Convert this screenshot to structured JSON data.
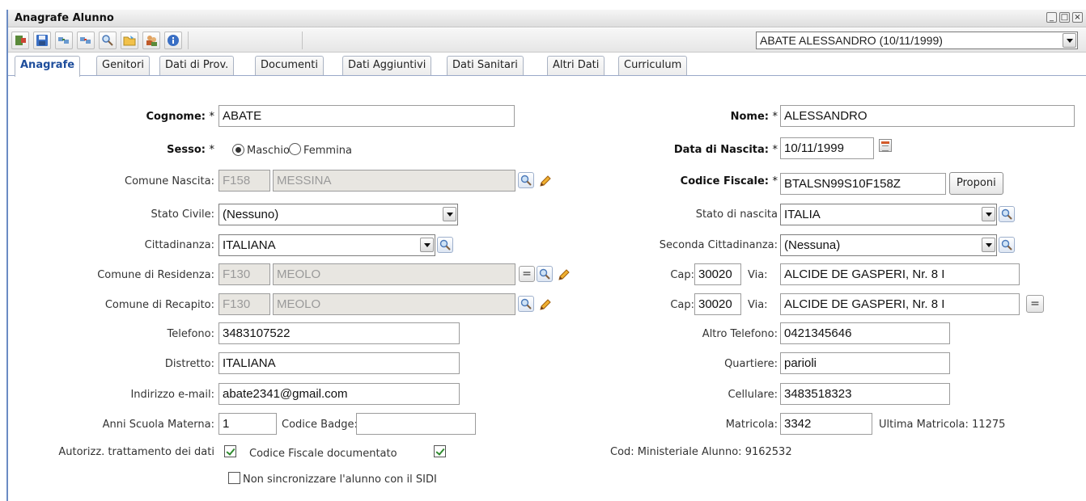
{
  "window": {
    "title": "Anagrafe Alunno"
  },
  "toolbar": {
    "buttons": [
      "exit-icon",
      "save-icon",
      "copy-record-icon",
      "delete-record-icon",
      "search-icon",
      "folder-icon",
      "users-icon",
      "info-icon"
    ],
    "student_selector": "ABATE ALESSANDRO (10/11/1999)"
  },
  "tabs": [
    "Anagrafe",
    "Genitori",
    "Dati di Prov.",
    "Documenti",
    "Dati Aggiuntivi",
    "Dati Sanitari",
    "Altri Dati",
    "Curriculum"
  ],
  "form": {
    "cognome": {
      "label": "Cognome:",
      "req": "*",
      "value": "ABATE"
    },
    "nome": {
      "label": "Nome:",
      "req": "*",
      "value": "ALESSANDRO"
    },
    "sesso": {
      "label": "Sesso:",
      "req": "*",
      "maschio": "Maschio",
      "femmina": "Femmina",
      "selected": "Maschio"
    },
    "data_nascita": {
      "label": "Data di Nascita:",
      "req": "*",
      "value": "10/11/1999"
    },
    "comune_nascita": {
      "label": "Comune Nascita:",
      "code": "F158",
      "name": "MESSINA"
    },
    "codice_fiscale": {
      "label": "Codice Fiscale:",
      "req": "*",
      "value": "BTALSN99S10F158Z",
      "button": "Proponi"
    },
    "stato_civile": {
      "label": "Stato Civile:",
      "value": "(Nessuno)"
    },
    "stato_nascita": {
      "label": "Stato di nascita",
      "value": "ITALIA"
    },
    "cittadinanza": {
      "label": "Cittadinanza:",
      "value": "ITALIANA"
    },
    "seconda_cittadinanza": {
      "label": "Seconda Cittadinanza:",
      "value": "(Nessuna)"
    },
    "comune_residenza": {
      "label": "Comune di Residenza:",
      "code": "F130",
      "name": "MEOLO"
    },
    "residenza_cap": {
      "cap_label": "Cap:",
      "cap": "30020",
      "via_label": "Via:",
      "via": "ALCIDE DE GASPERI, Nr. 8 I"
    },
    "comune_recapito": {
      "label": "Comune di Recapito:",
      "code": "F130",
      "name": "MEOLO"
    },
    "recapito_cap": {
      "cap_label": "Cap:",
      "cap": "30020",
      "via_label": "Via:",
      "via": "ALCIDE DE GASPERI, Nr. 8 I"
    },
    "telefono": {
      "label": "Telefono:",
      "value": "3483107522"
    },
    "altro_telefono": {
      "label": "Altro Telefono:",
      "value": "0421345646"
    },
    "distretto": {
      "label": "Distretto:",
      "value": "ITALIANA"
    },
    "quartiere": {
      "label": "Quartiere:",
      "value": "parioli"
    },
    "email": {
      "label": "Indirizzo e-mail:",
      "value": "abate2341@gmail.com"
    },
    "cellulare": {
      "label": "Cellulare:",
      "value": "3483518323"
    },
    "anni_materna": {
      "label": "Anni Scuola Materna:",
      "value": "1"
    },
    "codice_badge": {
      "label": "Codice Badge:",
      "value": ""
    },
    "matricola": {
      "label": "Matricola:",
      "value": "3342",
      "ultima_label": "Ultima Matricola: 11275"
    },
    "autorizz": {
      "label": "Autorizz. trattamento dei dati",
      "checked": true
    },
    "cf_documentato": {
      "label": "Codice Fiscale documentato",
      "checked": true
    },
    "cod_ministeriale": {
      "label": "Cod: Ministeriale Alunno: 9162532"
    },
    "non_sincronizzare": {
      "label": "Non sincronizzare l'alunno con il SIDI",
      "checked": false
    },
    "equals": "="
  }
}
